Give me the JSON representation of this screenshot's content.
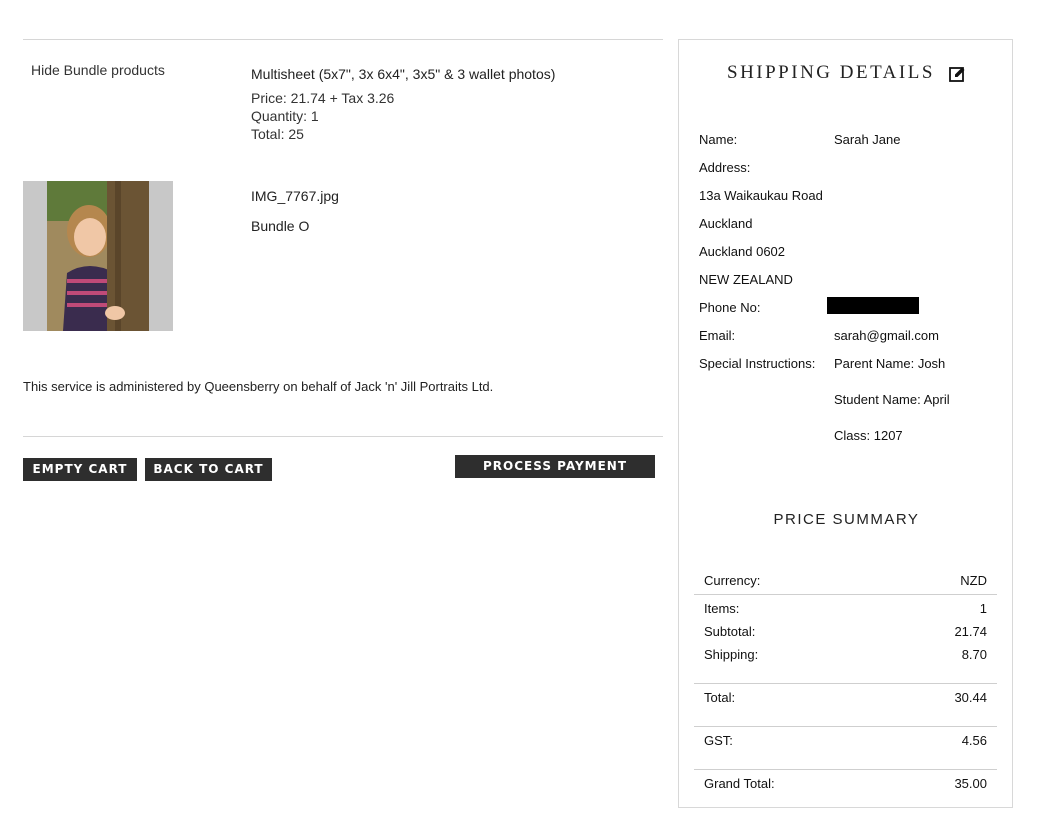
{
  "bundle": {
    "hide_label": "Hide Bundle products",
    "title": "Multisheet (5x7\", 3x 6x4\", 3x5\" & 3 wallet photos)",
    "price": "Price: 21.74 + Tax 3.26",
    "quantity": "Quantity: 1",
    "total": "Total: 25"
  },
  "item": {
    "file_name": "IMG_7767.jpg",
    "bundle_name": "Bundle O"
  },
  "notice": "This service is administered by Queensberry on behalf of Jack 'n' Jill Portraits Ltd.",
  "buttons": {
    "empty_cart": "EMPTY CART",
    "back_to_cart": "BACK TO CART",
    "process_payment": "PROCESS PAYMENT"
  },
  "shipping": {
    "title": "SHIPPING DETAILS",
    "edit_icon": "edit-icon",
    "name_label": "Name:",
    "name_value": "Sarah Jane",
    "address_label": "Address:",
    "address_lines": [
      "13a Waikaukau Road",
      "Auckland",
      "Auckland 0602",
      "NEW ZEALAND"
    ],
    "phone_label": "Phone No:",
    "email_label": "Email:",
    "email_value": "sarah@gmail.com",
    "instructions_label": "Special Instructions:",
    "instructions": [
      "Parent Name: Josh",
      "Student Name: April",
      "Class: 1207"
    ]
  },
  "price_summary": {
    "title": "PRICE SUMMARY",
    "currency_label": "Currency:",
    "currency_value": "NZD",
    "items_label": "Items:",
    "items_value": "1",
    "subtotal_label": "Subtotal:",
    "subtotal_value": "21.74",
    "shipping_label": "Shipping:",
    "shipping_value": "8.70",
    "total_label": "Total:",
    "total_value": "30.44",
    "gst_label": "GST:",
    "gst_value": "4.56",
    "grand_total_label": "Grand Total:",
    "grand_total_value": "35.00"
  }
}
